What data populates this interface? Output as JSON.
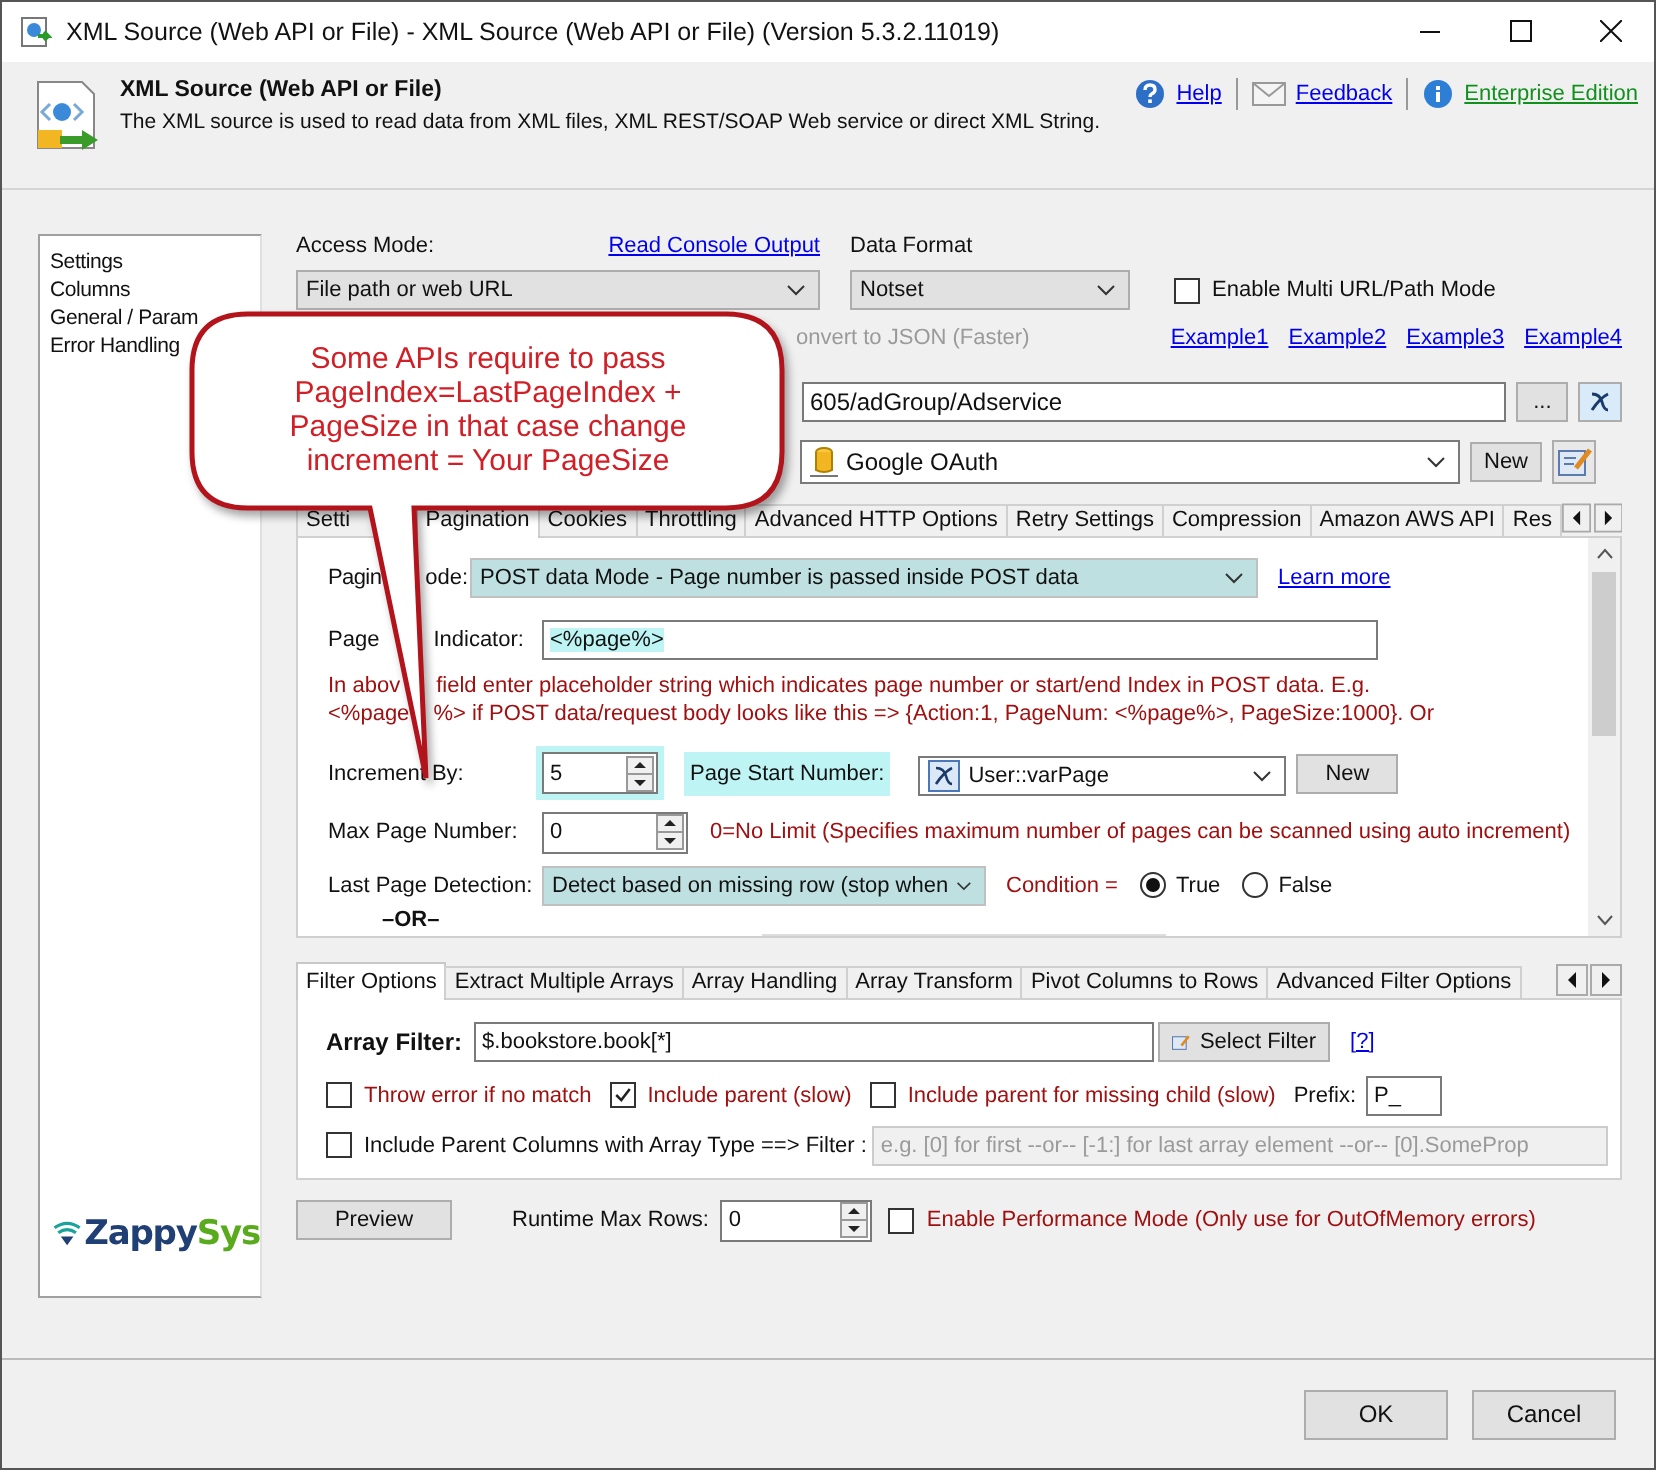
{
  "window": {
    "title": "XML Source (Web API or File) - XML Source (Web API or File) (Version 5.3.2.11019)"
  },
  "header": {
    "title": "XML Source (Web API or File)",
    "description": "The XML source is used to read data from XML files, XML REST/SOAP Web service or direct XML String.",
    "links": [
      {
        "label": "Help",
        "kind": "help"
      },
      {
        "label": "Feedback",
        "kind": "feedback"
      },
      {
        "label": "Enterprise Edition",
        "kind": "edition"
      }
    ]
  },
  "sidebar": {
    "items": [
      "Settings",
      "Columns",
      "General / Param",
      "Error Handling"
    ]
  },
  "access_mode": {
    "label": "Access Mode:",
    "value": "File path or web URL",
    "link": "Read Console Output"
  },
  "data_format": {
    "label": "Data Format",
    "value": "Notset"
  },
  "multi_url": {
    "label": "Enable Multi URL/Path Mode",
    "checked": false
  },
  "convert_json": {
    "label": "onvert to JSON (Faster)",
    "disabled": true
  },
  "examples": [
    "Example1",
    "Example2",
    "Example3",
    "Example4"
  ],
  "url": {
    "value": "605/adGroup/Adservice",
    "browse": "..."
  },
  "connection": {
    "value": "Google OAuth",
    "button": "New"
  },
  "callout": {
    "text": "Some APIs require to pass PageIndex=LastPageIndex + PageSize in that case change increment = Your PageSize"
  },
  "tabs": [
    {
      "label": "Setti",
      "selected": false
    },
    {
      "label": "Pagination",
      "selected": true
    },
    {
      "label": "Cookies",
      "selected": false
    },
    {
      "label": "Throttling",
      "selected": false
    },
    {
      "label": "Advanced HTTP Options",
      "selected": false
    },
    {
      "label": "Retry Settings",
      "selected": false
    },
    {
      "label": "Compression",
      "selected": false
    },
    {
      "label": "Amazon AWS API",
      "selected": false
    },
    {
      "label": "Res",
      "selected": false
    }
  ],
  "pagination": {
    "mode_label": [
      "Pagin",
      "ode:"
    ],
    "mode": "POST data Mode - Page number is passed inside POST data",
    "learn_more": "Learn more",
    "indicator_label": [
      "Page",
      "Indicator:"
    ],
    "indicator": "<%page%>",
    "hint_lines": [
      [
        "In abov",
        "field enter placeholder string which indicates page number or start/end Index in POST data. E.g."
      ],
      [
        "<%page",
        "%> if POST data/request body looks like this => {Action:1, PageNum: <%page%>, PageSize:1000}. Or"
      ]
    ],
    "increment_label": "Increment By:",
    "increment": "5",
    "start_label": "Page Start Number:",
    "start_value": "User::varPage",
    "start_button": "New",
    "max_label": "Max Page Number:",
    "max": "0",
    "max_note": "0=No Limit (Specifies maximum number of pages can be scanned using auto increment)",
    "last_label": "Last Page Detection:",
    "last_value": "Detect based on missing row (stop when",
    "condition_label": "Condition =",
    "condition_options": [
      {
        "label": "True",
        "selected": true
      },
      {
        "label": "False",
        "selected": false
      }
    ],
    "or": "–OR–"
  },
  "filter_tabs": [
    {
      "label": "Filter Options",
      "selected": true
    },
    {
      "label": "Extract Multiple Arrays",
      "selected": false
    },
    {
      "label": "Array Handling",
      "selected": false
    },
    {
      "label": "Array Transform",
      "selected": false
    },
    {
      "label": "Pivot Columns to Rows",
      "selected": false
    },
    {
      "label": "Advanced Filter Options",
      "selected": false
    }
  ],
  "filter": {
    "label": "Array Filter:",
    "value": "$.bookstore.book[*]",
    "button": "Select Filter",
    "help": "[?]",
    "options": [
      {
        "label": "Throw error if no match",
        "checked": false
      },
      {
        "label": "Include parent (slow)",
        "checked": true
      },
      {
        "label": "Include parent for missing child (slow)",
        "checked": false
      }
    ],
    "prefix_label": "Prefix:",
    "prefix": "P_",
    "parent_cols": {
      "label": "Include Parent Columns with Array Type ==> Filter :",
      "checked": false,
      "placeholder": "e.g. [0] for first --or-- [-1:] for last array element --or-- [0].SomeProp"
    }
  },
  "preview": {
    "button": "Preview",
    "max_rows_label": "Runtime Max Rows:",
    "max_rows": "0",
    "perf": {
      "label": "Enable Performance Mode (Only use for OutOfMemory errors)",
      "checked": false
    }
  },
  "logo": {
    "parts": [
      {
        "text": "Zappy",
        "color": "#1f3f75"
      },
      {
        "text": "Sys",
        "color": "#5aaa1e"
      }
    ]
  },
  "buttons": [
    "OK",
    "Cancel"
  ]
}
